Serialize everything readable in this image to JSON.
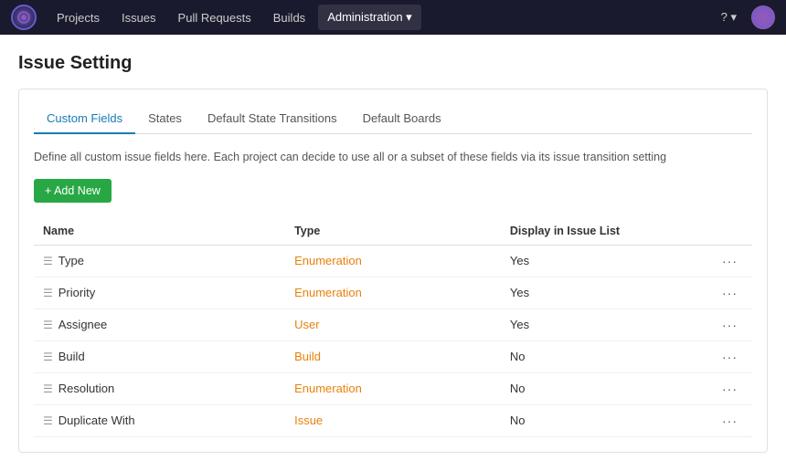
{
  "app": {
    "logo_label": "YouTrack"
  },
  "topnav": {
    "items": [
      {
        "label": "Projects",
        "active": false
      },
      {
        "label": "Issues",
        "active": false
      },
      {
        "label": "Pull Requests",
        "active": false
      },
      {
        "label": "Builds",
        "active": false
      },
      {
        "label": "Administration ▾",
        "active": true
      }
    ],
    "help_label": "? ▾",
    "user_tooltip": "User menu"
  },
  "page": {
    "title": "Issue Setting"
  },
  "tabs": [
    {
      "label": "Custom Fields",
      "active": true
    },
    {
      "label": "States",
      "active": false
    },
    {
      "label": "Default State Transitions",
      "active": false
    },
    {
      "label": "Default Boards",
      "active": false
    }
  ],
  "description": {
    "text_before_link": "Define all custom issue fields here. Each project can decide to use all or a subset of these fields via its issue transition setting",
    "link_text": ""
  },
  "add_button_label": "+ Add New",
  "table": {
    "columns": [
      {
        "label": "Name"
      },
      {
        "label": "Type"
      },
      {
        "label": "Display in Issue List"
      },
      {
        "label": ""
      }
    ],
    "rows": [
      {
        "name": "Type",
        "type": "Enumeration",
        "display": "Yes"
      },
      {
        "name": "Priority",
        "type": "Enumeration",
        "display": "Yes"
      },
      {
        "name": "Assignee",
        "type": "User",
        "display": "Yes"
      },
      {
        "name": "Build",
        "type": "Build",
        "display": "No"
      },
      {
        "name": "Resolution",
        "type": "Enumeration",
        "display": "No"
      },
      {
        "name": "Duplicate With",
        "type": "Issue",
        "display": "No"
      }
    ],
    "more_icon": "···"
  }
}
